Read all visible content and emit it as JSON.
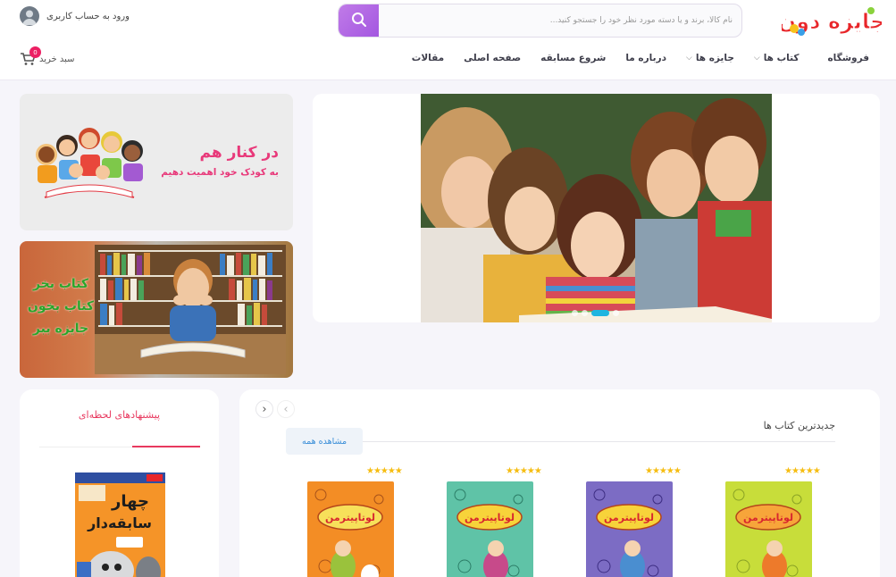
{
  "header": {
    "logo_text": "جایزه دون",
    "search_placeholder": "نام کالا، برند و یا دسته مورد نظر خود را جستجو کنید...",
    "login_label": "ورود به حساب کاربری",
    "cart_label": "سبد خرید",
    "cart_count": "0",
    "nav": [
      {
        "label": "فروشگاه",
        "dropdown": false
      },
      {
        "label": "کتاب ها",
        "dropdown": true
      },
      {
        "label": "جایزه ها",
        "dropdown": true
      },
      {
        "label": "درباره ما",
        "dropdown": false
      },
      {
        "label": "شروع مسابقه",
        "dropdown": false
      },
      {
        "label": "صفحه اصلی",
        "dropdown": false
      },
      {
        "label": "مقالات",
        "dropdown": false
      }
    ]
  },
  "banners": {
    "banner1": {
      "title": "در کنار هم",
      "subtitle": "به کودک خود اهمیت دهیم"
    },
    "banner2": {
      "line1": "کتاب بخر",
      "line2": "کتاب بخون",
      "line3": "جایزه ببر"
    }
  },
  "products": {
    "section_title": "جدیدترین کتاب ها",
    "see_all_label": "مشاهده همه",
    "rating_text": "★★★★★",
    "items": [
      {
        "cover_title": "لوتاپیترمن",
        "rating": 5,
        "color": "#c8dd3a"
      },
      {
        "cover_title": "لوتاپیترمن",
        "rating": 5,
        "color": "#7c6cc4"
      },
      {
        "cover_title": "لوتاپیترمن",
        "rating": 5,
        "color": "#5fc3a7"
      },
      {
        "cover_title": "لوتاپیترمن",
        "rating": 5,
        "color": "#f38d25"
      }
    ]
  },
  "suggestions": {
    "title": "پیشنهادهای لحظه‌ای",
    "book_title_line1": "چهار",
    "book_title_line2": "سابقه‌دار"
  },
  "colors": {
    "accent_purple": "#a356e0",
    "pink": "#e8397a",
    "badge": "#ec1f63",
    "star": "#f6bd11",
    "link_blue": "#3a8ed8"
  }
}
